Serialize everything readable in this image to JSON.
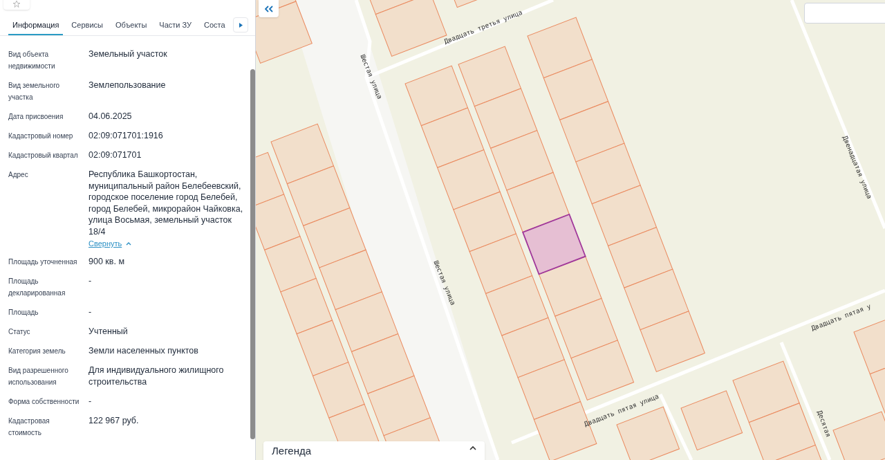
{
  "panel": {
    "tabs": [
      {
        "label": "Информация",
        "selected": true
      },
      {
        "label": "Сервисы",
        "selected": false
      },
      {
        "label": "Объекты",
        "selected": false
      },
      {
        "label": "Части ЗУ",
        "selected": false
      },
      {
        "label": "Соста",
        "selected": false
      }
    ],
    "fields": [
      {
        "label": "Вид объекта недвижимости",
        "value": "Земельный участок"
      },
      {
        "label": "Вид земельного участка",
        "value": "Землепользование"
      },
      {
        "label": "Дата присвоения",
        "value": "04.06.2025"
      },
      {
        "label": "Кадастровый номер",
        "value": "02:09:071701:1916"
      },
      {
        "label": "Кадастровый квартал",
        "value": "02:09:071701"
      },
      {
        "label": "Адрес",
        "value": "Республика Башкортостан, муниципальный район Белебеевский, городское поселение город Белебей, город Белебей, микрорайон Чайковка, улица Восьмая, земельный участок 18/4",
        "link": "Свернуть"
      },
      {
        "label": "Площадь уточненная",
        "value": "900 кв. м"
      },
      {
        "label": "Площадь декларированная",
        "value": "-"
      },
      {
        "label": "Площадь",
        "value": "-"
      },
      {
        "label": "Статус",
        "value": "Учтенный"
      },
      {
        "label": "Категория земель",
        "value": "Земли населенных пунктов"
      },
      {
        "label": "Вид разрешенного использования",
        "value": "Для индивидуального жилищного строительства"
      },
      {
        "label": "Форма собственности",
        "value": "-"
      },
      {
        "label": "Кадастровая стоимость",
        "value": "122 967 руб."
      }
    ]
  },
  "map": {
    "street_labels": [
      {
        "text": "Шестая улица"
      },
      {
        "text": "Двадцать третья улица"
      },
      {
        "text": "Шестая улица"
      },
      {
        "text": "Двенадцатая улица"
      },
      {
        "text": "Двадцать пятая у"
      },
      {
        "text": "Двадцать пятая улица"
      },
      {
        "text": "Десятая"
      }
    ],
    "legend": {
      "title": "Легенда"
    }
  }
}
